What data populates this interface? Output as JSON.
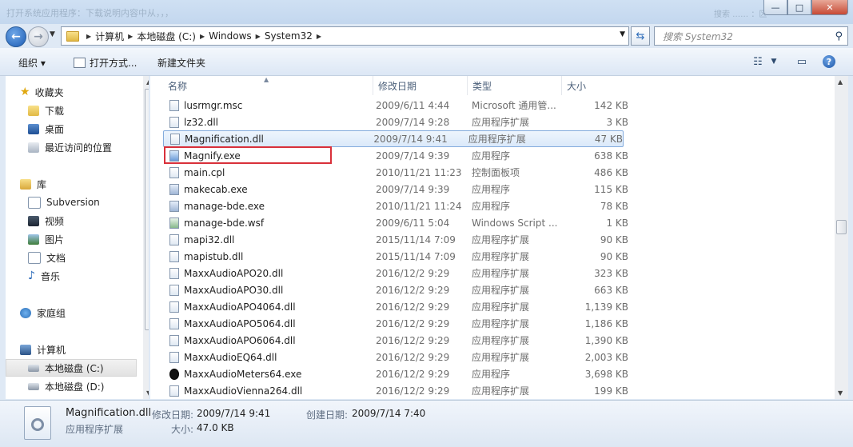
{
  "window": {
    "title_faded": "打开系统应用程序：下载说明内容中从，，，",
    "ghost_text": "搜索 ……  ：区",
    "buttons": {
      "minimize": "—",
      "maximize": "□",
      "close": "✕"
    }
  },
  "address": {
    "crumbs": [
      "计算机",
      "本地磁盘 (C:)",
      "Windows",
      "System32"
    ],
    "search_placeholder": "搜索 System32"
  },
  "toolbar": {
    "organize": "组织 ▾",
    "open_with": "打开方式...",
    "new_folder": "新建文件夹"
  },
  "sidebar": {
    "favorites": "收藏夹",
    "downloads": "下载",
    "desktop": "桌面",
    "recent": "最近访问的位置",
    "libraries": "库",
    "subversion": "Subversion",
    "videos": "视频",
    "pictures": "图片",
    "documents": "文档",
    "music": "音乐",
    "homegroup": "家庭组",
    "computer": "计算机",
    "drive_c": "本地磁盘 (C:)",
    "drive_d": "本地磁盘 (D:)"
  },
  "columns": {
    "name": "名称",
    "date": "修改日期",
    "type": "类型",
    "size": "大小"
  },
  "files": [
    {
      "name": "lusrmgr.msc",
      "date": "2009/6/11 4:44",
      "type": "Microsoft 通用管...",
      "size": "142 KB"
    },
    {
      "name": "lz32.dll",
      "date": "2009/7/14 9:28",
      "type": "应用程序扩展",
      "size": "3 KB"
    },
    {
      "name": "Magnification.dll",
      "date": "2009/7/14 9:41",
      "type": "应用程序扩展",
      "size": "47 KB"
    },
    {
      "name": "Magnify.exe",
      "date": "2009/7/14 9:39",
      "type": "应用程序",
      "size": "638 KB"
    },
    {
      "name": "main.cpl",
      "date": "2010/11/21 11:23",
      "type": "控制面板项",
      "size": "486 KB"
    },
    {
      "name": "makecab.exe",
      "date": "2009/7/14 9:39",
      "type": "应用程序",
      "size": "115 KB"
    },
    {
      "name": "manage-bde.exe",
      "date": "2010/11/21 11:24",
      "type": "应用程序",
      "size": "78 KB"
    },
    {
      "name": "manage-bde.wsf",
      "date": "2009/6/11 5:04",
      "type": "Windows Script ...",
      "size": "1 KB"
    },
    {
      "name": "mapi32.dll",
      "date": "2015/11/14 7:09",
      "type": "应用程序扩展",
      "size": "90 KB"
    },
    {
      "name": "mapistub.dll",
      "date": "2015/11/14 7:09",
      "type": "应用程序扩展",
      "size": "90 KB"
    },
    {
      "name": "MaxxAudioAPO20.dll",
      "date": "2016/12/2 9:29",
      "type": "应用程序扩展",
      "size": "323 KB"
    },
    {
      "name": "MaxxAudioAPO30.dll",
      "date": "2016/12/2 9:29",
      "type": "应用程序扩展",
      "size": "663 KB"
    },
    {
      "name": "MaxxAudioAPO4064.dll",
      "date": "2016/12/2 9:29",
      "type": "应用程序扩展",
      "size": "1,139 KB"
    },
    {
      "name": "MaxxAudioAPO5064.dll",
      "date": "2016/12/2 9:29",
      "type": "应用程序扩展",
      "size": "1,186 KB"
    },
    {
      "name": "MaxxAudioAPO6064.dll",
      "date": "2016/12/2 9:29",
      "type": "应用程序扩展",
      "size": "1,390 KB"
    },
    {
      "name": "MaxxAudioEQ64.dll",
      "date": "2016/12/2 9:29",
      "type": "应用程序扩展",
      "size": "2,003 KB"
    },
    {
      "name": "MaxxAudioMeters64.exe",
      "date": "2016/12/2 9:29",
      "type": "应用程序",
      "size": "3,698 KB"
    },
    {
      "name": "MaxxAudioVienna264.dll",
      "date": "2016/12/2 9:29",
      "type": "应用程序扩展",
      "size": "199 KB"
    }
  ],
  "details": {
    "filename": "Magnification.dll",
    "filetype": "应用程序扩展",
    "modified_label": "修改日期:",
    "modified_value": "2009/7/14 9:41",
    "created_label": "创建日期:",
    "created_value": "2009/7/14 7:40",
    "size_label": "大小:",
    "size_value": "47.0 KB"
  },
  "colors": {
    "selection_border": "#84acdd",
    "highlight_box": "#d9303a"
  }
}
